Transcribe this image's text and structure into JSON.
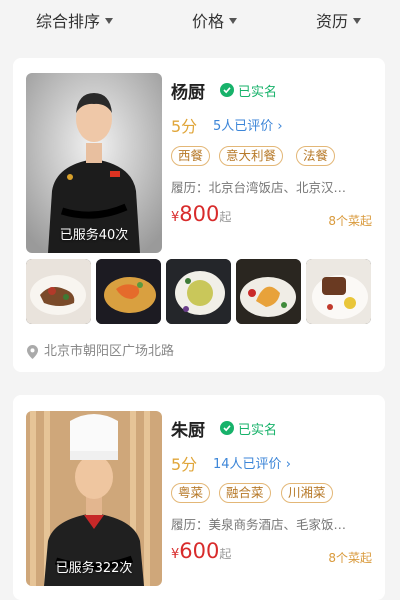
{
  "filters": {
    "sort": "综合排序",
    "price": "价格",
    "experience": "资历"
  },
  "chefs": [
    {
      "name": "杨厨",
      "verified": "已实名",
      "score": "5分",
      "reviews": "5人已评价",
      "tags": [
        "西餐",
        "意大利餐",
        "法餐"
      ],
      "history": "履历：北京台湾饭店、北京汉…",
      "price_currency": "¥",
      "price_value": "800",
      "price_suffix": "起",
      "menu_count": "8个菜起",
      "served": "已服务40次",
      "location": "北京市朝阳区广场北路"
    },
    {
      "name": "朱厨",
      "verified": "已实名",
      "score": "5分",
      "reviews": "14人已评价",
      "tags": [
        "粤菜",
        "融合菜",
        "川湘菜"
      ],
      "history": "履历：美泉商务酒店、毛家饭…",
      "price_currency": "¥",
      "price_value": "600",
      "price_suffix": "起",
      "menu_count": "8个菜起",
      "served": "已服务322次"
    }
  ],
  "colors": {
    "accent_green": "#17b26a",
    "price_red": "#d82b2b",
    "score_gold": "#e0a63a",
    "review_blue": "#3d86d8",
    "tag_border": "#e3b777"
  }
}
